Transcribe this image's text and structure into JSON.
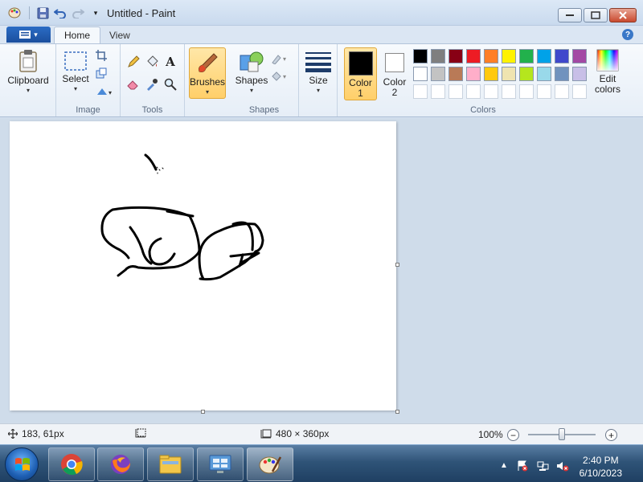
{
  "window": {
    "title": "Untitled - Paint"
  },
  "tabs": [
    {
      "label": "Home"
    },
    {
      "label": "View"
    }
  ],
  "ribbon": {
    "clipboard": {
      "label": "Clipboard"
    },
    "image": {
      "select_label": "Select",
      "group_label": "Image"
    },
    "tools": {
      "group_label": "Tools"
    },
    "brushes": {
      "label": "Brushes"
    },
    "shapes": {
      "label": "Shapes",
      "group_label": "Shapes"
    },
    "size": {
      "label": "Size"
    },
    "color1": {
      "label_line1": "Color",
      "label_line2": "1",
      "value": "#000000"
    },
    "color2": {
      "label_line1": "Color",
      "label_line2": "2",
      "value": "#ffffff"
    },
    "colors": {
      "group_label": "Colors",
      "edit_line1": "Edit",
      "edit_line2": "colors",
      "palette_row1": [
        "#000000",
        "#7f7f7f",
        "#880015",
        "#ed1c24",
        "#ff7f27",
        "#fff200",
        "#22b14c",
        "#00a2e8",
        "#3f48cc",
        "#a349a4"
      ],
      "palette_row2": [
        "#ffffff",
        "#c3c3c3",
        "#b97a57",
        "#ffaec9",
        "#ffc90e",
        "#efe4b0",
        "#b5e61d",
        "#99d9ea",
        "#7092be",
        "#c8bfe7"
      ]
    }
  },
  "statusbar": {
    "cursor_pos": "183, 61px",
    "canvas_size": "480 × 360px",
    "zoom": "100%"
  },
  "taskbar": {
    "time": "2:40 PM",
    "date": "6/10/2023",
    "apps": [
      "chrome-icon",
      "firefox-icon",
      "file-explorer-icon",
      "control-panel-icon",
      "paint-icon"
    ]
  }
}
